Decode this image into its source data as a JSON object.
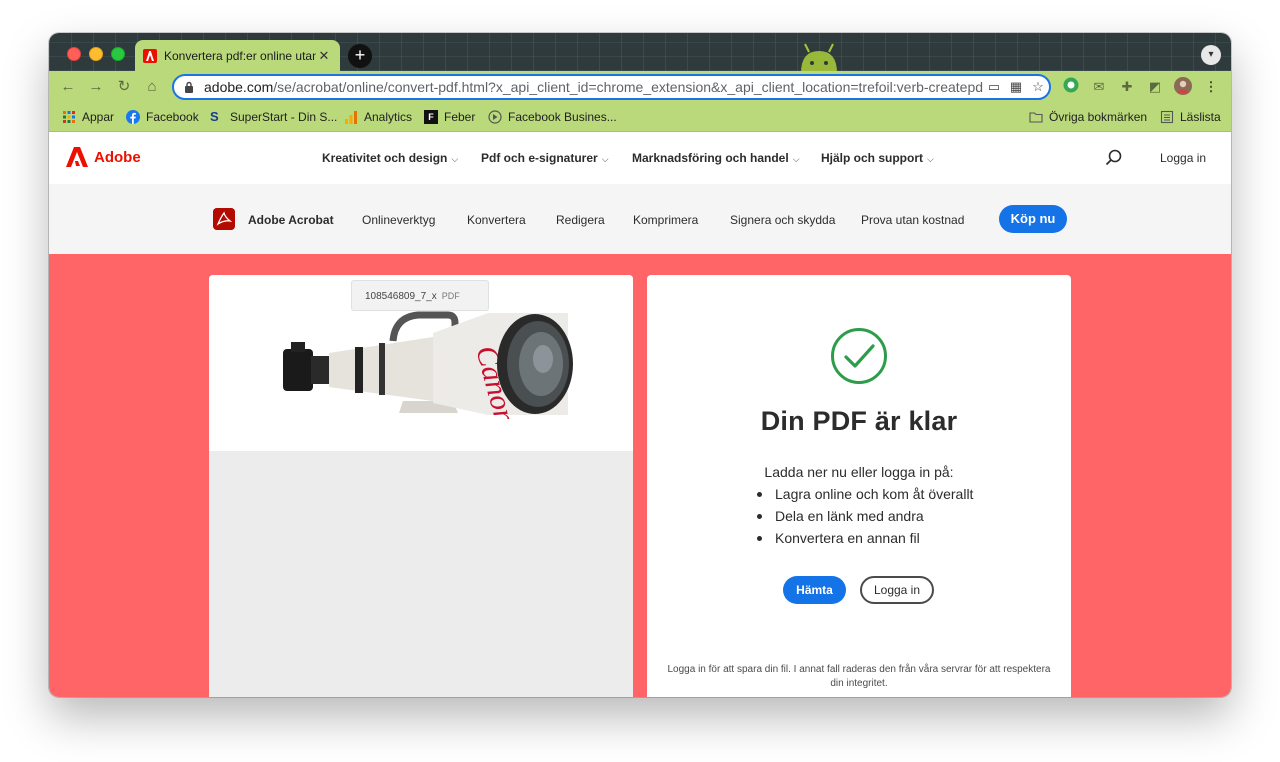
{
  "browser": {
    "tab_title": "Konvertera pdf:er online utan k",
    "tab_close": "✕",
    "new_tab": "+",
    "url_host": "adobe.com",
    "url_path": "/se/acrobat/online/convert-pdf.html?x_api_client_id=chrome_extension&x_api_client_location=trefoil:verb-createpdf&...",
    "nav_icons": [
      "back-icon",
      "forward-icon",
      "reload-icon",
      "home-icon"
    ]
  },
  "bookmarks": {
    "items": [
      {
        "label": "Appar",
        "icon": "apps-grid-icon"
      },
      {
        "label": "Facebook",
        "icon": "facebook-icon"
      },
      {
        "label": "SuperStart - Din S...",
        "icon": "superstart-icon"
      },
      {
        "label": "Analytics",
        "icon": "analytics-icon"
      },
      {
        "label": "Feber",
        "icon": "feber-icon"
      },
      {
        "label": "Facebook Busines...",
        "icon": "facebook-business-icon"
      }
    ],
    "other": "Övriga bokmärken",
    "reading_list": "Läslista"
  },
  "global_nav": {
    "brand": "Adobe",
    "menus": [
      "Kreativitet och design",
      "Pdf och e-signaturer",
      "Marknadsföring och handel",
      "Hjälp och support"
    ],
    "login": "Logga in"
  },
  "acrobat_nav": {
    "product": "Adobe Acrobat",
    "items": [
      "Onlineverktyg",
      "Konvertera",
      "Redigera",
      "Komprimera",
      "Signera och skydda",
      "Prova utan kostnad"
    ],
    "buy": "Köp nu"
  },
  "preview": {
    "file_name": "108546809_7_x",
    "file_ext": "PDF",
    "lens_brand": "Canon"
  },
  "result": {
    "title": "Din PDF är klar",
    "intro": "Ladda ner nu eller logga in på:",
    "bullets": [
      "Lagra online och kom åt överallt",
      "Dela en länk med andra",
      "Konvertera en annan fil"
    ],
    "download_button": "Hämta",
    "login_button": "Logga in",
    "disclaimer": "Logga in för att spara din fil. I annat fall raderas den från våra servrar för att respektera din integritet."
  },
  "colors": {
    "hero_bg": "#ff6466",
    "adobe_red": "#eb1000",
    "primary_blue": "#1473e6",
    "browser_theme": "#b9d97a",
    "success_green": "#2d9d4b"
  }
}
